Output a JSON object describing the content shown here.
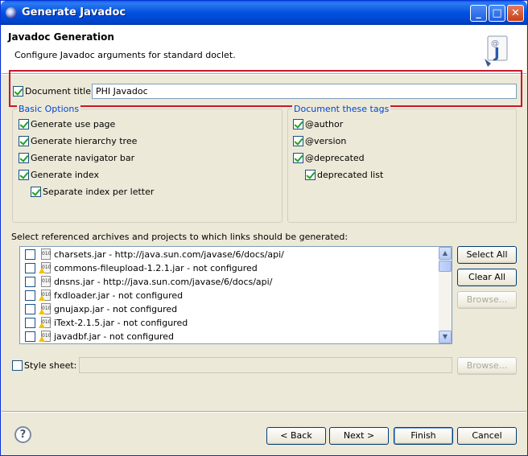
{
  "window": {
    "title": "Generate Javadoc"
  },
  "header": {
    "title": "Javadoc Generation",
    "message": "Configure Javadoc arguments for standard doclet."
  },
  "document_title": {
    "label": "Document title:",
    "checked": true,
    "value": "PHI Javadoc"
  },
  "basic_options": {
    "title": "Basic Options",
    "items": [
      {
        "label": "Generate use page",
        "checked": true
      },
      {
        "label": "Generate hierarchy tree",
        "checked": true
      },
      {
        "label": "Generate navigator bar",
        "checked": true
      },
      {
        "label": "Generate index",
        "checked": true
      },
      {
        "label": "Separate index per letter",
        "checked": true
      }
    ]
  },
  "document_tags": {
    "title": "Document these tags",
    "items": [
      {
        "label": "@author",
        "checked": true
      },
      {
        "label": "@version",
        "checked": true
      },
      {
        "label": "@deprecated",
        "checked": true
      },
      {
        "label": "deprecated list",
        "checked": true
      }
    ]
  },
  "archives": {
    "label": "Select referenced archives and projects to which links should be generated:",
    "items": [
      {
        "label": "charsets.jar - http://java.sun.com/javase/6/docs/api/",
        "warning": false
      },
      {
        "label": "commons-fileupload-1.2.1.jar - not configured",
        "warning": true
      },
      {
        "label": "dnsns.jar - http://java.sun.com/javase/6/docs/api/",
        "warning": false
      },
      {
        "label": "fxdloader.jar - not configured",
        "warning": true
      },
      {
        "label": "gnujaxp.jar - not configured",
        "warning": true
      },
      {
        "label": "iText-2.1.5.jar - not configured",
        "warning": true
      },
      {
        "label": "javadbf.jar - not configured",
        "warning": true
      }
    ],
    "buttons": {
      "select_all": "Select All",
      "clear_all": "Clear All",
      "browse": "Browse..."
    }
  },
  "style_sheet": {
    "label": "Style sheet:",
    "checked": false,
    "value": "",
    "browse": "Browse..."
  },
  "footer": {
    "help": "?",
    "back": "< Back",
    "next": "Next >",
    "finish": "Finish",
    "cancel": "Cancel"
  }
}
